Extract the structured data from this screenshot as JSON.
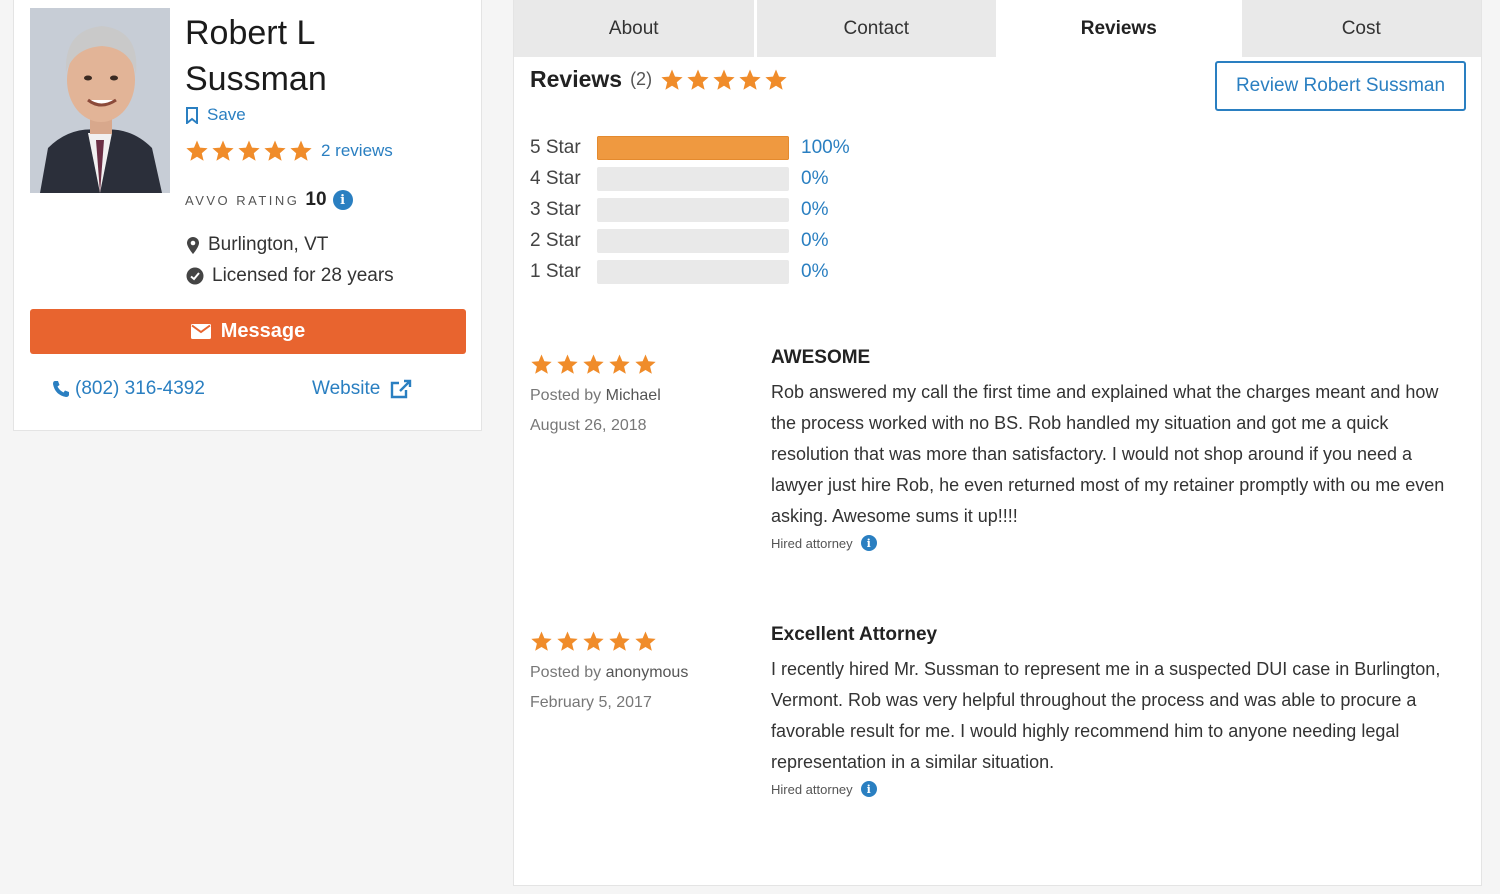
{
  "profile": {
    "name_line1": "Robert L",
    "name_line2": "Sussman",
    "save_label": "Save",
    "rating_stars": 5,
    "reviews_link": "2 reviews",
    "avvo_label": "AVVO RATING",
    "avvo_value": "10",
    "location": "Burlington, VT",
    "licensed": "Licensed for 28 years",
    "message_label": "Message",
    "phone": "(802) 316-4392",
    "website_label": "Website"
  },
  "tabs": [
    {
      "label": "About"
    },
    {
      "label": "Contact"
    },
    {
      "label": "Reviews",
      "active": true
    },
    {
      "label": "Cost"
    }
  ],
  "reviews_section": {
    "title": "Reviews",
    "count": "(2)",
    "stars": 5,
    "review_button": "Review Robert Sussman",
    "breakdown": [
      {
        "label": "5 Star",
        "percent": 100,
        "pct_text": "100%"
      },
      {
        "label": "4 Star",
        "percent": 0,
        "pct_text": "0%"
      },
      {
        "label": "3 Star",
        "percent": 0,
        "pct_text": "0%"
      },
      {
        "label": "2 Star",
        "percent": 0,
        "pct_text": "0%"
      },
      {
        "label": "1 Star",
        "percent": 0,
        "pct_text": "0%"
      }
    ]
  },
  "reviews": [
    {
      "stars": 5,
      "posted_prefix": "Posted by",
      "author": "Michael",
      "date": "August 26, 2018",
      "title": "AWESOME",
      "body": "Rob answered my call the first time and explained what the charges meant and how the process worked with no BS. Rob handled my situation and got me a quick resolution that was more than satisfactory. I would not shop around if you need a lawyer just hire Rob, he even returned most of my retainer promptly with ou me even asking. Awesome sums it up!!!!",
      "hired": "Hired attorney"
    },
    {
      "stars": 5,
      "posted_prefix": "Posted by",
      "author": "anonymous",
      "date": "February 5, 2017",
      "title": "Excellent Attorney",
      "body": "I recently hired Mr. Sussman to represent me in a suspected DUI case in Burlington, Vermont. Rob was very helpful throughout the process and was able to procure a favorable result for me. I would highly recommend him to anyone needing legal representation in a similar situation.",
      "hired": "Hired attorney"
    }
  ],
  "colors": {
    "star": "#f08c2a",
    "accent_blue": "#2a7fc1",
    "message_orange": "#e8642f",
    "bar_fill": "#ef9940"
  }
}
